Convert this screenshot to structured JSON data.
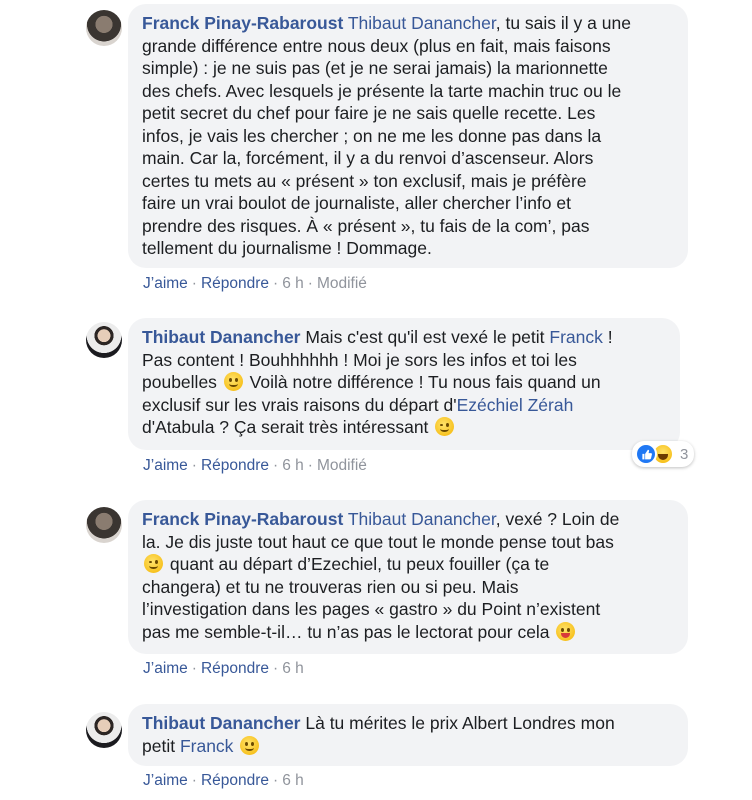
{
  "comments": [
    {
      "author": "Franck Pinay-Rabaroust",
      "mention": "Thibaut Danancher",
      "first_line_rest": ", tu sais il y a une",
      "lines": [
        "grande différence entre nous deux (plus en fait, mais faisons",
        "simple) : je ne suis pas (et je ne serai jamais) la marionnette",
        "des chefs. Avec lesquels je présente la tarte machin truc ou le",
        "petit secret du chef pour faire je ne sais quelle recette. Les",
        "infos, je vais les chercher ; on ne me les donne pas dans la",
        "main. Car la, forcément, il y a du renvoi d’ascenseur. Alors",
        "certes tu mets au « présent » ton exclusif, mais je préfère",
        "faire un vrai boulot de journaliste, aller chercher l’info et",
        "prendre des risques. À « présent », tu fais de la com’, pas",
        "tellement du journalisme ! Dommage."
      ],
      "like": "J’aime",
      "reply": "Répondre",
      "time": "6 h",
      "edited": "Modifié"
    },
    {
      "author": "Thibaut Danancher",
      "l1_a": "Mais c'est qu'il est vexé le petit ",
      "l1_mention": "Franck",
      "l1_b": " !",
      "l2": "Pas content ! Bouhhhhhh ! Moi je sors les infos et toi les",
      "l3_a": "poubelles ",
      "l3_b": " Voilà notre différence ! Tu nous fais quand un",
      "l4_a": "exclusif sur les vrais raisons du départ d'",
      "l4_mention": "Ezéchiel Zérah",
      "l5": "d'Atabula ? Ça serait très intéressant ",
      "like": "J’aime",
      "reply": "Répondre",
      "time": "6 h",
      "edited": "Modifié",
      "reaction_count": "3"
    },
    {
      "author": "Franck Pinay-Rabaroust",
      "mention": "Thibaut Danancher",
      "first_line_rest": ", vexé ? Loin de",
      "l2": "la. Je dis juste tout haut ce que tout le monde pense tout bas",
      "l3": " quant au départ d’Ezechiel, tu peux fouiller (ça te",
      "l4": "changera) et tu ne trouveras rien ou si peu. Mais",
      "l5": "l’investigation dans les pages « gastro » du Point n’existent",
      "l6": "pas me semble-t-il… tu n’as pas le lectorat pour cela ",
      "like": "J’aime",
      "reply": "Répondre",
      "time": "6 h"
    },
    {
      "author": "Thibaut Danancher",
      "l1": " Là tu mérites le prix Albert Londres mon",
      "l2_a": "petit ",
      "l2_mention": "Franck",
      "like": "J’aime",
      "reply": "Répondre",
      "time": "6 h"
    }
  ],
  "colors": {
    "link": "#385898",
    "meta": "#90949c",
    "bubble": "#f2f3f5"
  },
  "icons": [
    "smile-emoji-icon",
    "wink-emoji-icon",
    "tongue-emoji-icon",
    "like-reaction-icon",
    "haha-reaction-icon"
  ]
}
